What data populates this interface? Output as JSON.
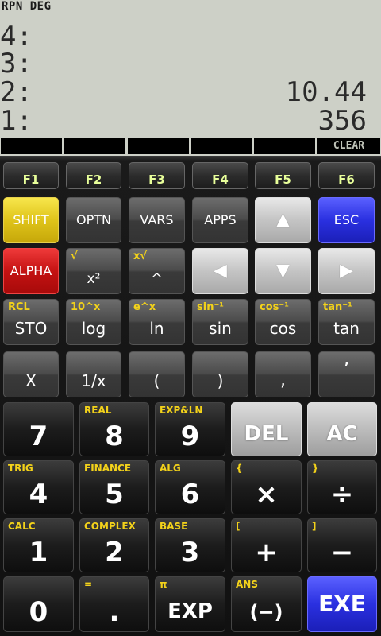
{
  "status": "RPN DEG",
  "stack": [
    {
      "level": "4:",
      "value": ""
    },
    {
      "level": "3:",
      "value": ""
    },
    {
      "level": "2:",
      "value": "10.44"
    },
    {
      "level": "1:",
      "value": "356"
    }
  ],
  "softkeys": [
    "",
    "",
    "",
    "",
    "",
    "CLEAR"
  ],
  "fn_keys": [
    "F1",
    "F2",
    "F3",
    "F4",
    "F5",
    "F6"
  ],
  "row2": {
    "shift": "SHIFT",
    "optn": "OPTN",
    "vars": "VARS",
    "apps": "APPS",
    "up": "▲",
    "esc": "ESC"
  },
  "row3": {
    "alpha": "ALPHA",
    "square": {
      "label": "x²",
      "sub": "√"
    },
    "power": {
      "label": "^",
      "sub": "x√"
    },
    "left": "◀",
    "down": "▼",
    "right": "▶"
  },
  "row4": {
    "sto": {
      "label": "STO",
      "sub": "RCL"
    },
    "log": {
      "label": "log",
      "sub": "10^x"
    },
    "ln": {
      "label": "ln",
      "sub": "e^x"
    },
    "sin": {
      "label": "sin",
      "sub": "sin⁻¹"
    },
    "cos": {
      "label": "cos",
      "sub": "cos⁻¹"
    },
    "tan": {
      "label": "tan",
      "sub": "tan⁻¹"
    }
  },
  "row5": {
    "x": "X",
    "recip": "1/x",
    "lparen": "(",
    "rparen": ")",
    "comma": ",",
    "prime": "ʼ"
  },
  "row6": {
    "seven": {
      "label": "7",
      "sub": ""
    },
    "eight": {
      "label": "8",
      "sub": "REAL"
    },
    "nine": {
      "label": "9",
      "sub": "EXP&LN"
    },
    "del": "DEL",
    "ac": "AC"
  },
  "row7": {
    "four": {
      "label": "4",
      "sub": "TRIG"
    },
    "five": {
      "label": "5",
      "sub": "FINANCE"
    },
    "six": {
      "label": "6",
      "sub": "ALG"
    },
    "mul": {
      "label": "×",
      "sub": "{"
    },
    "div": {
      "label": "÷",
      "sub": "}"
    }
  },
  "row8": {
    "one": {
      "label": "1",
      "sub": "CALC"
    },
    "two": {
      "label": "2",
      "sub": "COMPLEX"
    },
    "three": {
      "label": "3",
      "sub": "BASE"
    },
    "add": {
      "label": "+",
      "sub": "["
    },
    "sub": {
      "label": "−",
      "sub": "]"
    }
  },
  "row9": {
    "zero": {
      "label": "0",
      "sub": ""
    },
    "dot": {
      "label": ".",
      "sub": "="
    },
    "exp": {
      "label": "EXP",
      "sub": "π"
    },
    "neg": {
      "label": "(−)",
      "sub": "ANS"
    },
    "exe": "EXE"
  },
  "colors": {
    "lcd": "#cdd0c7",
    "shift": "#dfc41a",
    "alpha": "#c41212",
    "esc": "#2a30e0",
    "sublabel": "#f3d21a",
    "fn_label": "#e8ff9a"
  }
}
